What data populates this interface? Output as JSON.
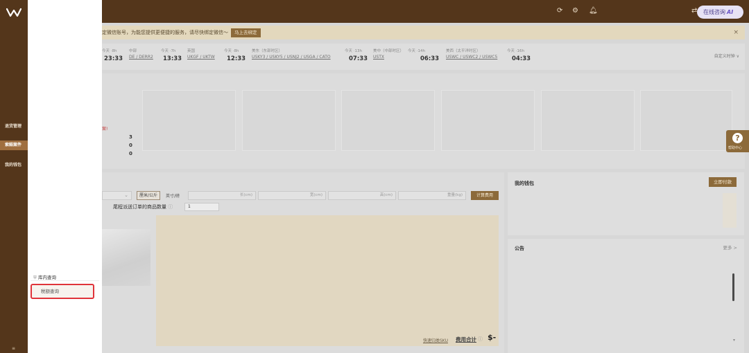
{
  "colors": {
    "brand_dark": "#54361b",
    "brand_accent": "#8c6a3a",
    "sidebar_active": "#a06f3f",
    "highlight_border": "#e0333a"
  },
  "topbar": {
    "icons": [
      "refresh-icon",
      "settings-icon",
      "bell-icon",
      "translate-icon"
    ],
    "online_label": "在线咨询",
    "online_badge": "AI"
  },
  "sidebar": {
    "items": [
      {
        "label": "退货管理",
        "active": false
      },
      {
        "label": "索赔案件",
        "active": true
      },
      {
        "label": "我的钱包",
        "active": false
      }
    ],
    "bottom_mark": "≡"
  },
  "flyout": {
    "stock_label": "库内查询",
    "query_label": "税额查询"
  },
  "notice": {
    "text": "定微信账号，为能您提供更便捷的服务，请尽快绑定微信～",
    "button": "马上去绑定",
    "close": "×"
  },
  "clocks": [
    {
      "label": "今天 ·8h",
      "codes": "",
      "time": "23:33"
    },
    {
      "label": "中部",
      "codes": "DE / DERR2",
      "time": ""
    },
    {
      "label": "今天 ·7h",
      "codes": "",
      "time": "13:33"
    },
    {
      "label": "英国",
      "codes": "UKGF / UKTW",
      "time": ""
    },
    {
      "label": "今天 ·8h",
      "codes": "",
      "time": "12:33"
    },
    {
      "label": "美东（东部时区）",
      "codes": "USKY3 / USKY5 / USNJ2 / USGA / CATO",
      "time": ""
    },
    {
      "label": "今天 ·13h",
      "codes": "",
      "time": "07:33"
    },
    {
      "label": "美中（中部时区）",
      "codes": "USTX",
      "time": ""
    },
    {
      "label": "今天 ·14h",
      "codes": "",
      "time": "06:33"
    },
    {
      "label": "美西（太平洋时区）",
      "codes": "USWC / USWC2 / USWC5",
      "time": ""
    },
    {
      "label": "今天 ·16h",
      "codes": "",
      "time": "04:33"
    }
  ],
  "custom_time": "自定义时钟 ∨",
  "summary": {
    "red_note": "案!",
    "numbers": [
      "3",
      "0",
      "0"
    ]
  },
  "calculator": {
    "unit_toggle": "厘米/公斤",
    "unit_alt": "英寸/磅",
    "length_placeholder": "长(cm)",
    "width_placeholder": "宽(cm)",
    "height_placeholder": "高(cm)",
    "weight_placeholder": "重量(kg)",
    "calc_button": "计算费用",
    "qty_label": "尾程派送订单的商品数量",
    "qty_value": "1",
    "sum_link": "快速归类SKU",
    "fee_label": "费用合计",
    "fee_value": "$-"
  },
  "wallet": {
    "title": "我的钱包",
    "pay_button": "立即付款"
  },
  "announcement": {
    "title": "公告",
    "more": "更多 >"
  },
  "help": {
    "label": "帮助中心"
  }
}
